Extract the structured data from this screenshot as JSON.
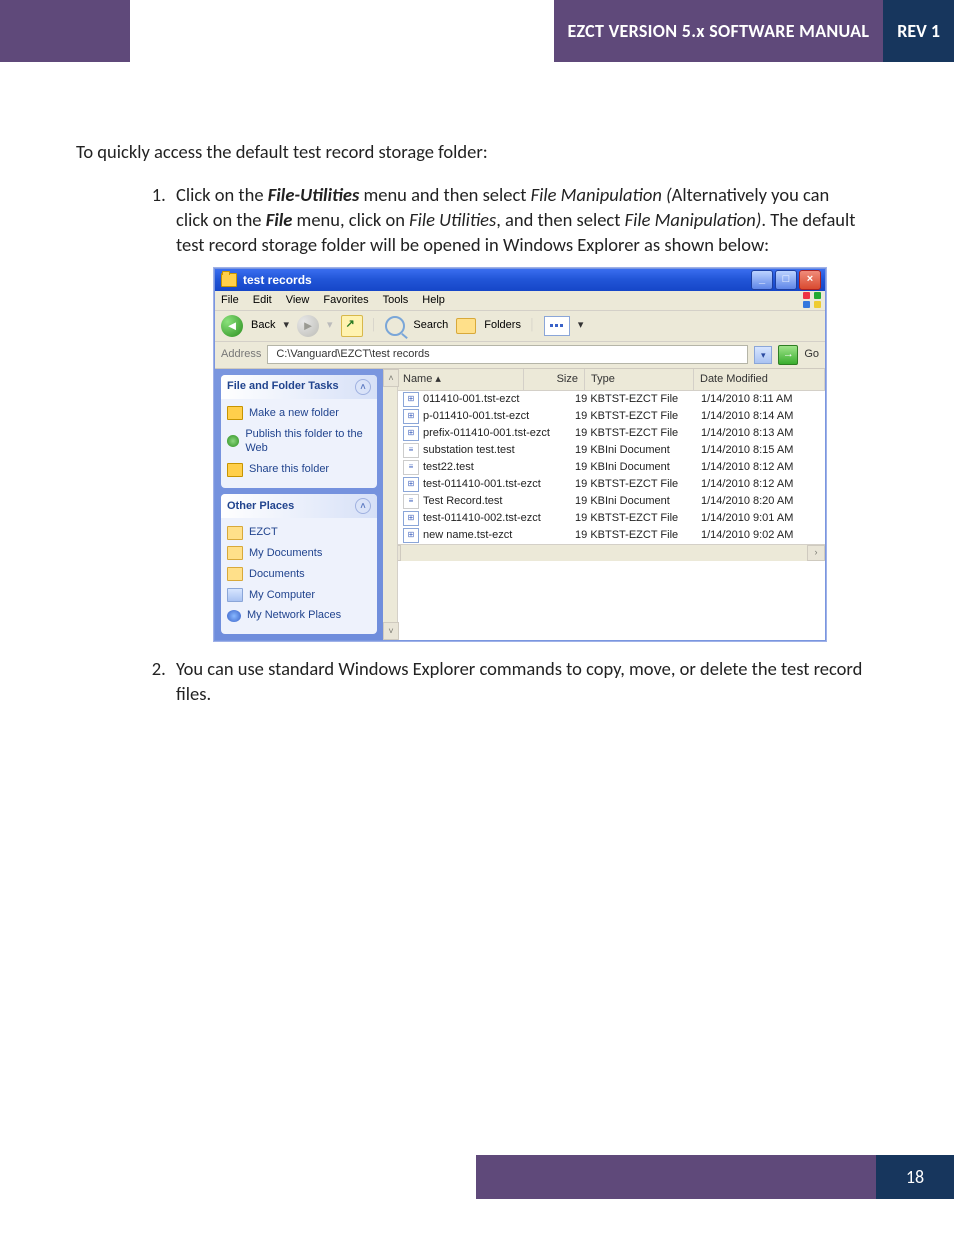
{
  "header": {
    "title": "EZCT VERSION 5.x SOFTWARE MANUAL",
    "rev": "REV 1"
  },
  "body": {
    "intro": "To quickly access the default test record storage folder:",
    "step1_pre": "Click on the ",
    "step1_menu1": "File-Utilities",
    "step1_mid1": " menu and then select ",
    "step1_it1": "File Manipulation (",
    "step1_mid2": "Alternatively you can click on the ",
    "step1_menu2": "File",
    "step1_mid3": " menu, click on ",
    "step1_it2": "File Utilities",
    "step1_mid4": ", and then select ",
    "step1_it3": "File Manipulation)",
    "step1_tail": ". The default test record storage folder will be opened in Windows Explorer as shown below:",
    "step2": "You can use standard Windows Explorer commands to copy, move, or delete the test record files."
  },
  "explorer": {
    "title": "test records",
    "menu": [
      "File",
      "Edit",
      "View",
      "Favorites",
      "Tools",
      "Help"
    ],
    "toolbar": {
      "back": "Back",
      "search": "Search",
      "folders": "Folders"
    },
    "address_label": "Address",
    "address_path": "C:\\Vanguard\\EZCT\\test records",
    "go": "Go",
    "side": {
      "panel1_title": "File and Folder Tasks",
      "panel1_items": [
        "Make a new folder",
        "Publish this folder to the Web",
        "Share this folder"
      ],
      "panel2_title": "Other Places",
      "panel2_items": [
        "EZCT",
        "My Documents",
        "Documents",
        "My Computer",
        "My Network Places"
      ]
    },
    "columns": {
      "name": "Name",
      "size": "Size",
      "type": "Type",
      "date": "Date Modified"
    },
    "files": [
      {
        "n": "011410-001.tst-ezct",
        "s": "19 KB",
        "t": "TST-EZCT File",
        "d": "1/14/2010 8:11 AM",
        "k": "ez"
      },
      {
        "n": "p-011410-001.tst-ezct",
        "s": "19 KB",
        "t": "TST-EZCT File",
        "d": "1/14/2010 8:14 AM",
        "k": "ez"
      },
      {
        "n": "prefix-011410-001.tst-ezct",
        "s": "19 KB",
        "t": "TST-EZCT File",
        "d": "1/14/2010 8:13 AM",
        "k": "ez"
      },
      {
        "n": "substation test.test",
        "s": "19 KB",
        "t": "Ini Document",
        "d": "1/14/2010 8:15 AM",
        "k": "doc"
      },
      {
        "n": "test22.test",
        "s": "19 KB",
        "t": "Ini Document",
        "d": "1/14/2010 8:12 AM",
        "k": "doc"
      },
      {
        "n": "test-011410-001.tst-ezct",
        "s": "19 KB",
        "t": "TST-EZCT File",
        "d": "1/14/2010 8:12 AM",
        "k": "ez"
      },
      {
        "n": "Test Record.test",
        "s": "19 KB",
        "t": "Ini Document",
        "d": "1/14/2010 8:20 AM",
        "k": "doc"
      },
      {
        "n": "test-011410-002.tst-ezct",
        "s": "19 KB",
        "t": "TST-EZCT File",
        "d": "1/14/2010 9:01 AM",
        "k": "ez"
      },
      {
        "n": "new name.tst-ezct",
        "s": "19 KB",
        "t": "TST-EZCT File",
        "d": "1/14/2010 9:02 AM",
        "k": "ez"
      }
    ]
  },
  "footer": {
    "page": "18"
  }
}
